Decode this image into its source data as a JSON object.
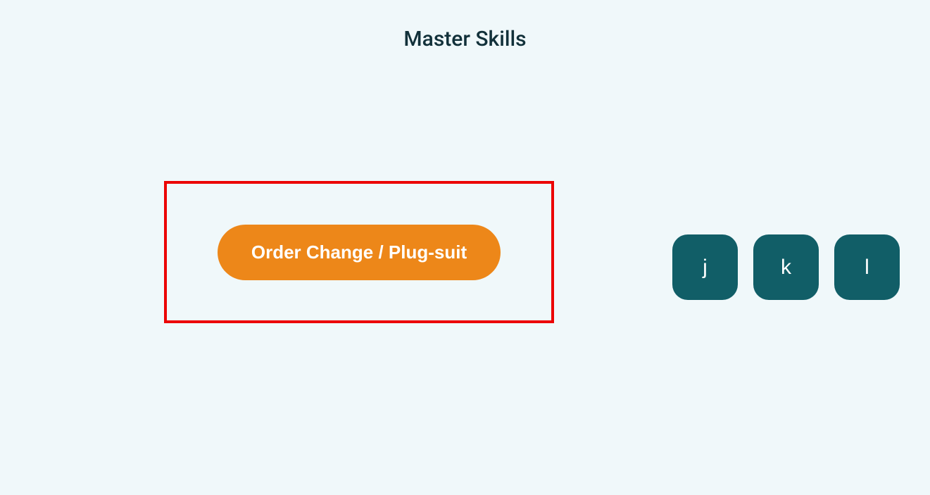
{
  "title": "Master Skills",
  "highlight": {
    "button_label": "Order Change / Plug-suit"
  },
  "keys": {
    "k0": "j",
    "k1": "k",
    "k2": "l"
  }
}
